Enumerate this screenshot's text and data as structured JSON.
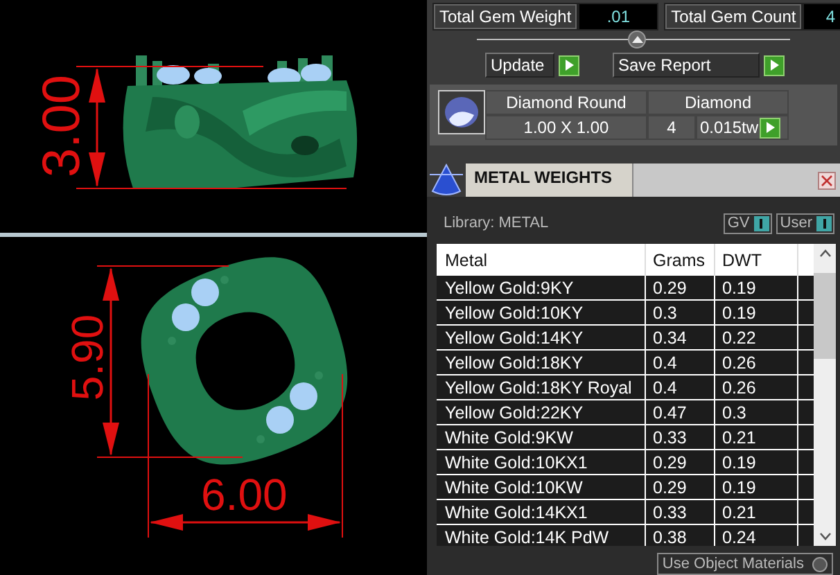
{
  "viewport": {
    "top_view": {
      "height_dimension": "3.00"
    },
    "bottom_view": {
      "height_dimension": "5.90",
      "width_dimension": "6.00"
    }
  },
  "totals": [
    {
      "label": "Total Gem Weight",
      "value": ".01"
    },
    {
      "label": "Total Gem Count",
      "value": "4"
    }
  ],
  "actions": [
    "Update",
    "Save Report"
  ],
  "gem": {
    "name": "Diamond Round",
    "size": "1.00 X 1.00",
    "material": "Diamond",
    "count": "4",
    "weight": "0.015tw"
  },
  "metal_weights": {
    "title": "METAL WEIGHTS",
    "library": "Library: METAL",
    "toggles": [
      {
        "label": "GV",
        "on": true
      },
      {
        "label": "User",
        "on": true
      }
    ],
    "table": {
      "columns": [
        "Metal",
        "Grams",
        "DWT"
      ],
      "rows": [
        [
          "Yellow Gold:9KY",
          "0.29",
          "0.19"
        ],
        [
          "Yellow Gold:10KY",
          "0.3",
          "0.19"
        ],
        [
          "Yellow Gold:14KY",
          "0.34",
          "0.22"
        ],
        [
          "Yellow Gold:18KY",
          "0.4",
          "0.26"
        ],
        [
          "Yellow Gold:18KY Royal",
          "0.4",
          "0.26"
        ],
        [
          "Yellow Gold:22KY",
          "0.47",
          "0.3"
        ],
        [
          "White Gold:9KW",
          "0.33",
          "0.21"
        ],
        [
          "White Gold:10KX1",
          "0.29",
          "0.19"
        ],
        [
          "White Gold:10KW",
          "0.29",
          "0.19"
        ],
        [
          "White Gold:14KX1",
          "0.33",
          "0.21"
        ],
        [
          "White Gold:14K PdW",
          "0.38",
          "0.24"
        ]
      ]
    },
    "use_object_materials": {
      "label": "Use Object Materials",
      "checked": false
    }
  }
}
